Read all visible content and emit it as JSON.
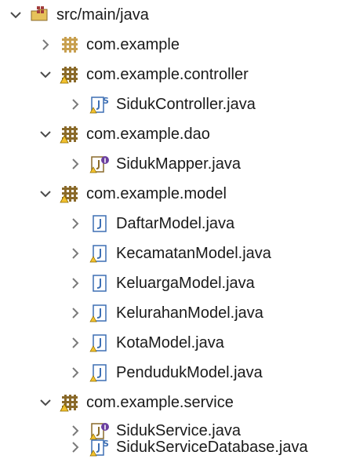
{
  "tree": {
    "root": {
      "label": "src/main/java",
      "expanded": true,
      "icon": "source-folder-icon"
    },
    "items": [
      {
        "label": "com.example",
        "expanded": false,
        "icon": "empty-package-icon",
        "children": []
      },
      {
        "label": "com.example.controller",
        "expanded": true,
        "icon": "package-icon",
        "children": [
          {
            "label": "SidukController.java",
            "icon": "java-class-icon"
          }
        ]
      },
      {
        "label": "com.example.dao",
        "expanded": true,
        "icon": "package-icon",
        "children": [
          {
            "label": "SidukMapper.java",
            "icon": "java-interface-icon"
          }
        ]
      },
      {
        "label": "com.example.model",
        "expanded": true,
        "icon": "package-icon",
        "children": [
          {
            "label": "DaftarModel.java",
            "icon": "java-file-icon"
          },
          {
            "label": "KecamatanModel.java",
            "icon": "java-file-icon"
          },
          {
            "label": "KeluargaModel.java",
            "icon": "java-file-icon"
          },
          {
            "label": "KelurahanModel.java",
            "icon": "java-file-icon"
          },
          {
            "label": "KotaModel.java",
            "icon": "java-file-icon"
          },
          {
            "label": "PendudukModel.java",
            "icon": "java-file-icon"
          }
        ]
      },
      {
        "label": "com.example.service",
        "expanded": true,
        "icon": "package-icon",
        "children": [
          {
            "label": "SidukService.java",
            "icon": "java-interface-icon"
          },
          {
            "label": "SidukServiceDatabase.java",
            "icon": "java-class-icon"
          }
        ]
      }
    ]
  },
  "colors": {
    "twisty": "#5a5a5a",
    "package_brown": "#8a6a2a",
    "package_yellow": "#e8b43c",
    "java_blue": "#3d6fb4",
    "java_file_fill": "#ffffff",
    "warning_yellow": "#f2c12e"
  }
}
